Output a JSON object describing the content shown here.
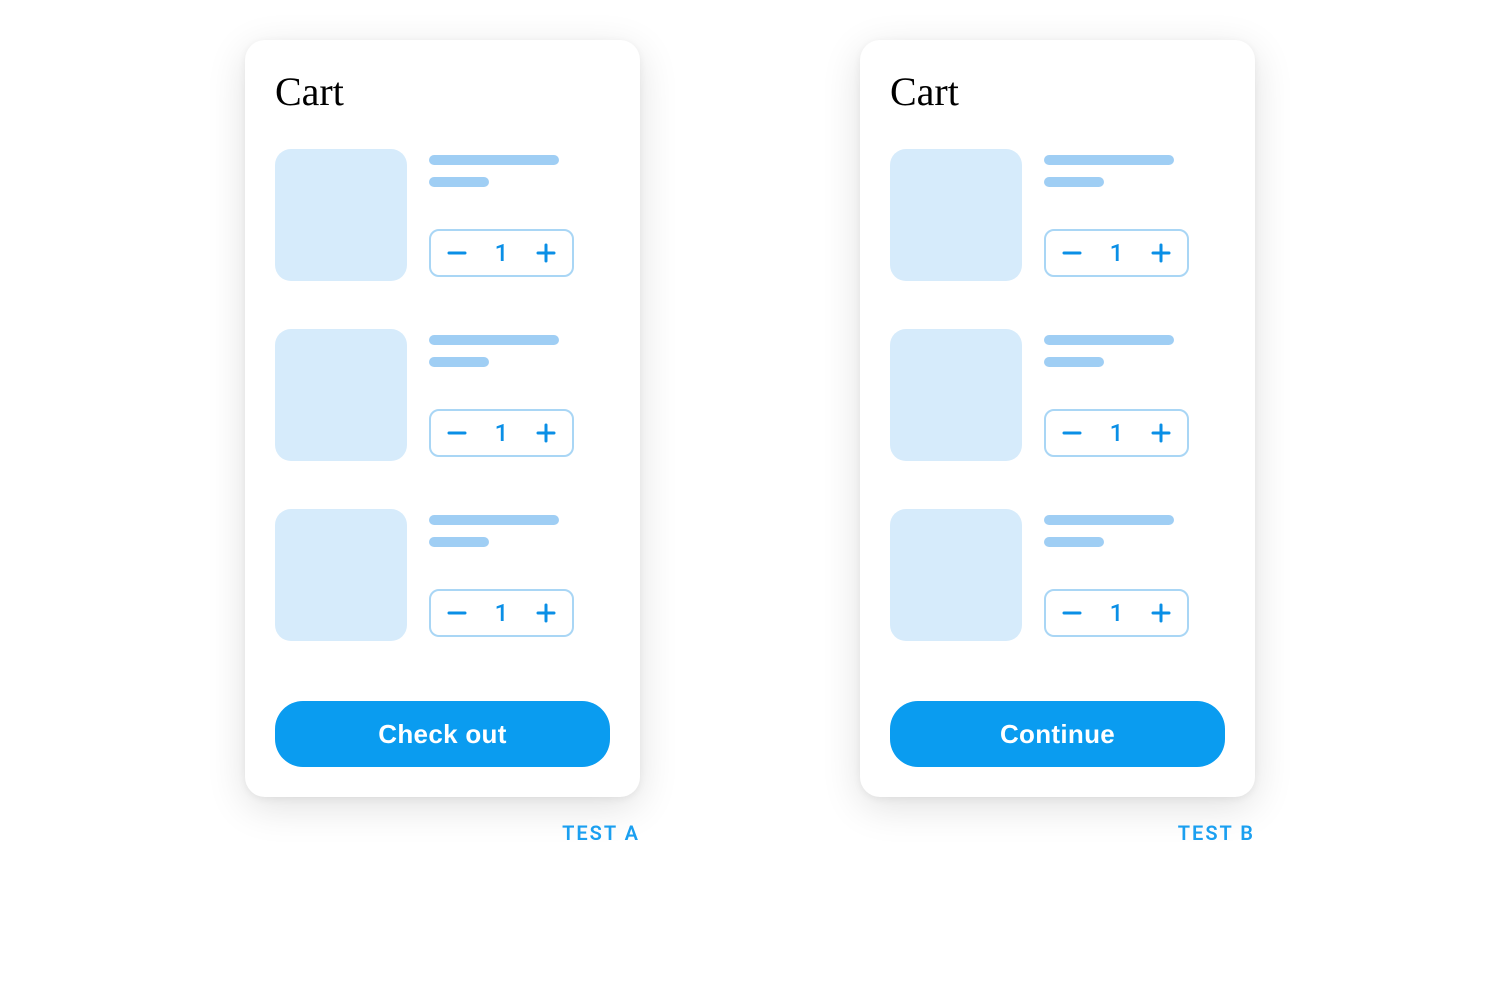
{
  "variants": [
    {
      "title": "Cart",
      "test_label": "TEST A",
      "cta_label": "Check out",
      "items": [
        {
          "qty": "1"
        },
        {
          "qty": "1"
        },
        {
          "qty": "1"
        }
      ]
    },
    {
      "title": "Cart",
      "test_label": "TEST B",
      "cta_label": "Continue",
      "items": [
        {
          "qty": "1"
        },
        {
          "qty": "1"
        },
        {
          "qty": "1"
        }
      ]
    }
  ]
}
